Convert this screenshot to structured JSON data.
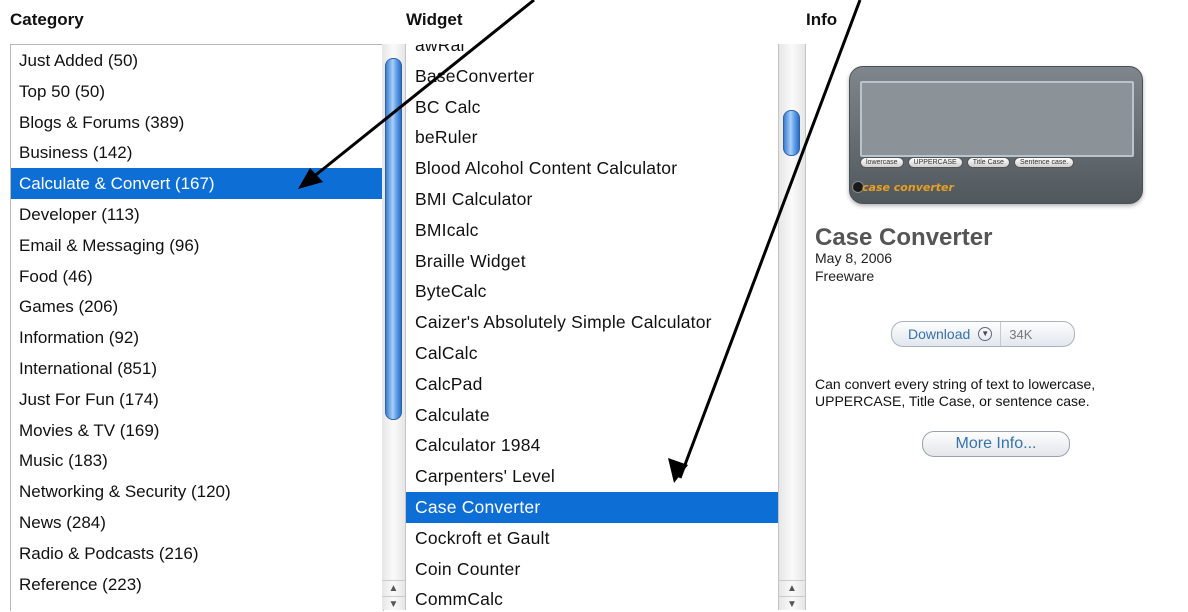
{
  "headers": {
    "category": "Category",
    "widget": "Widget",
    "info": "Info"
  },
  "categories": [
    "Just Added (50)",
    "Top 50 (50)",
    "Blogs & Forums (389)",
    "Business (142)",
    "Calculate & Convert (167)",
    "Developer (113)",
    "Email & Messaging (96)",
    "Food (46)",
    "Games (206)",
    "Information (92)",
    "International (851)",
    "Just For Fun (174)",
    "Movies & TV (169)",
    "Music (183)",
    "Networking & Security (120)",
    "News (284)",
    "Radio & Podcasts (216)",
    "Reference (223)"
  ],
  "selected_category_index": 4,
  "widgets": [
    "awRal",
    "BaseConverter",
    "BC Calc",
    "beRuler",
    "Blood Alcohol Content Calculator",
    "BMI Calculator",
    "BMIcalc",
    "Braille Widget",
    "ByteCalc",
    "Caizer's Absolutely Simple Calculator",
    "CalCalc",
    "CalcPad",
    "Calculate",
    "Calculator 1984",
    "Carpenters' Level",
    "Case Converter",
    "Cockroft et Gault",
    "Coin Counter",
    "CommCalc"
  ],
  "selected_widget_index": 15,
  "info": {
    "thumbnail_buttons": [
      "lowercase",
      "UPPERCASE",
      "Title Case",
      "Sentence case."
    ],
    "thumbnail_brand": "case converter",
    "title": "Case Converter",
    "date": "May 8, 2006",
    "license": "Freeware",
    "download_label": "Download",
    "download_size": "34K",
    "description": "Can convert every string of text to lowercase, UPPERCASE, Title Case, or sentence case.",
    "more_info_label": "More Info..."
  },
  "colors": {
    "selection": "#0d6fd6",
    "link_blue": "#3672ad",
    "scroll_thumb": "#5e9ee8"
  },
  "icons": {
    "scroll_up": "scroll-up-arrow-icon",
    "scroll_down": "scroll-down-arrow-icon",
    "download_chevron": "chevron-down-icon"
  }
}
